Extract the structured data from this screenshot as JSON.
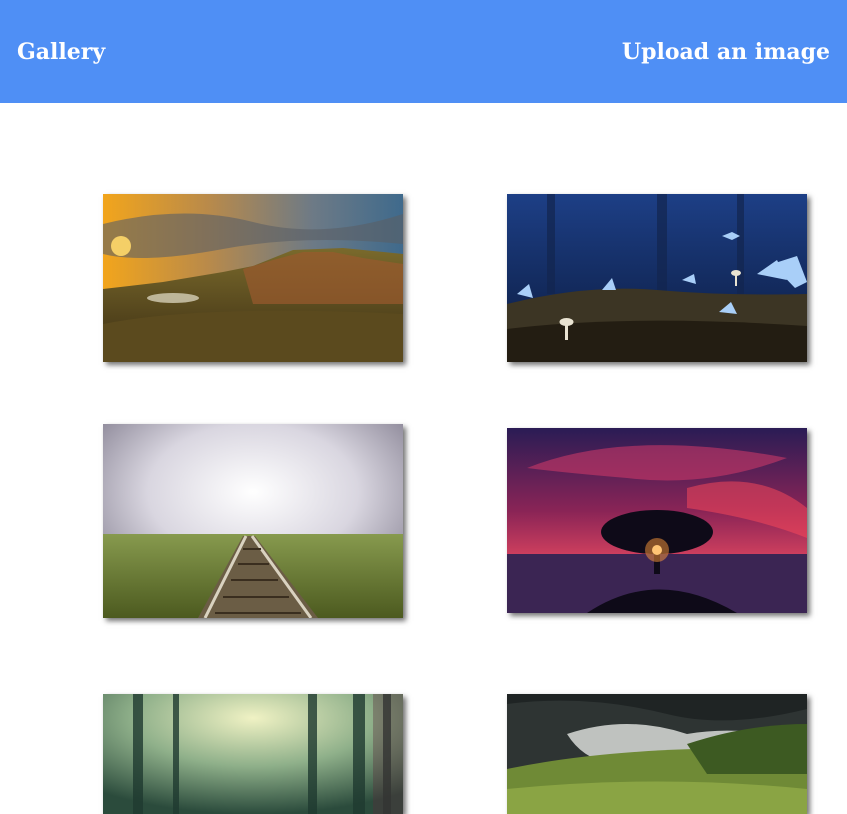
{
  "header": {
    "title": "Gallery",
    "upload_label": "Upload an image",
    "background_color": "#4f8ff5",
    "text_color": "#ffffff"
  },
  "gallery": {
    "images": [
      {
        "subject": "mountain-sunset"
      },
      {
        "subject": "blue-butterflies-mushrooms"
      },
      {
        "subject": "railway-field-clouds"
      },
      {
        "subject": "tree-silhouette-red-sky"
      },
      {
        "subject": "misty-forest"
      },
      {
        "subject": "green-hills-clouds"
      }
    ]
  }
}
